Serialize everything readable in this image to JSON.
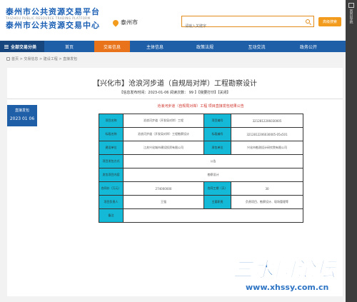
{
  "header": {
    "title_line1": "泰州市公共资源交易平台",
    "title_en": "TAIZHOU PUBLIC RESOURCE TRADING PLATFORM",
    "title_line2": "泰州市公共资源交易中心",
    "city": "泰州市",
    "search_placeholder": "请输入关键字",
    "advanced_search": "高级搜索"
  },
  "sidebar": {
    "home_label": "首页导航"
  },
  "nav": {
    "all_categories": "全部交易分类",
    "items": [
      "首页",
      "交易信息",
      "主体信息",
      "政策法规",
      "互动交流",
      "政务公开"
    ],
    "active_index": 1
  },
  "breadcrumb": "首页 > 交易信息 > 建设工程 > 直接发包",
  "notice": {
    "title": "【兴化市】沧浪河步道（自规局对岸）工程勘察设计",
    "meta": "【信息发布时间：2023-01-06  阅读次数： 99 】【我要打印】【关闭】",
    "date_block_label": "直接发包",
    "date_block_date": "2023 01 06",
    "announcement_title": "沧浪河步道（自规局对岸）工程 项目直接发包结果公告"
  },
  "table": {
    "rows": [
      [
        "项目名称",
        "沧浪河步道（开发局对岸）工程",
        "项目编号",
        "3212812206030005"
      ],
      [
        "标段名称",
        "沧浪河步道（开发局对岸）工程勘察设计",
        "标段编号",
        "3212812206030005-05x501"
      ],
      [
        "建设单位",
        "江苏兴化城市建设投资有限公司",
        "承包单位",
        "兴化市勘测设计研究院有限公司"
      ],
      [
        "项目发包方式",
        "公告"
      ],
      [
        "发包项目内容",
        "勘察设计"
      ],
      [
        "合同价（万元）",
        "274000000",
        "合同工期（天）",
        "30"
      ],
      [
        "项目负责人",
        "王强",
        "主要职责",
        "负责项目、勘察设计、现场管理等"
      ],
      [
        "备注",
        ""
      ]
    ]
  },
  "watermark": {
    "text": "三水园论坛",
    "url": "www.xhssy.com.cn"
  },
  "colors": {
    "brand_blue": "#1f5fa8",
    "accent_orange": "#e8731a",
    "table_label_cyan": "#13b9d6",
    "notice_red": "#d0342c"
  }
}
